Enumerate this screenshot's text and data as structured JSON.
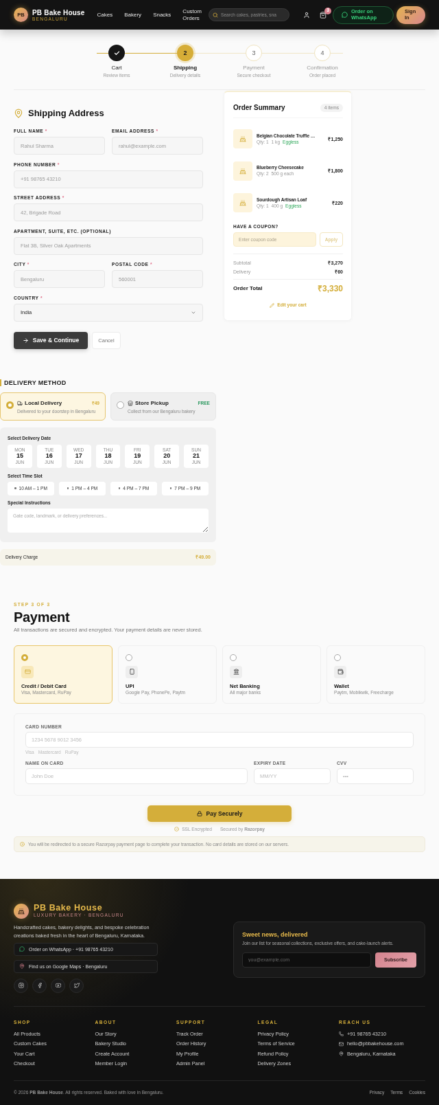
{
  "header": {
    "logo": "PB",
    "brand": "PB Bake House",
    "tagline": "BENGALURU",
    "nav": [
      "Cakes",
      "Bakery",
      "Snacks",
      "Custom Orders"
    ],
    "search": {
      "placeholder": "Search cakes, pastries, sna"
    },
    "cart_count": "3",
    "whatsapp": "Order on WhatsApp",
    "sign_in": "Sign In"
  },
  "stepper": {
    "steps": [
      {
        "label": "Cart",
        "note": "Review items",
        "completed": true,
        "selected": false
      },
      {
        "number": "2",
        "label": "Shipping",
        "note": "Delivery details",
        "completed": false,
        "selected": true
      },
      {
        "number": "3",
        "label": "Payment",
        "note": "Secure checkout",
        "completed": false,
        "selected": false
      },
      {
        "number": "4",
        "label": "Confirmation",
        "note": "Order placed",
        "completed": false,
        "selected": false
      }
    ]
  },
  "shipping": {
    "title": "Shipping Address",
    "rows": [
      [
        {
          "kind": "text",
          "label": "FULL NAME",
          "mark": "*",
          "placeholder": "Rahul Sharma"
        },
        {
          "kind": "text",
          "label": "EMAIL ADDRESS",
          "mark": "*",
          "placeholder": "rahul@example.com"
        }
      ],
      [
        {
          "kind": "text",
          "label": "PHONE NUMBER",
          "mark": "*",
          "placeholder": "+91 98765 43210"
        }
      ],
      [
        {
          "kind": "text",
          "label": "STREET ADDRESS",
          "mark": "*",
          "placeholder": "42, Brigade Road"
        }
      ],
      [
        {
          "kind": "text",
          "label": "APARTMENT, SUITE, ETC. (OPTIONAL)",
          "placeholder": "Flat 3B, Silver Oak Apartments"
        }
      ],
      [
        {
          "kind": "text",
          "label": "CITY",
          "mark": "*",
          "placeholder": "Bengaluru"
        },
        {
          "kind": "text",
          "label": "POSTAL CODE",
          "mark": "*",
          "placeholder": "560001"
        }
      ],
      [
        {
          "kind": "select",
          "label": "COUNTRY",
          "mark": "*",
          "value": "India"
        }
      ]
    ],
    "save": "Save & Continue",
    "cancel": "Cancel"
  },
  "order_summary": {
    "title": "Order Summary",
    "count": "4 items",
    "items": [
      {
        "name": "Belgian Chocolate Truffle …",
        "qty": "Qty: 1",
        "size": "1 kg",
        "tag": "Eggless",
        "price": "₹1,250"
      },
      {
        "name": "Blueberry Cheesecake",
        "qty": "Qty: 2",
        "size": "500 g each",
        "price": "₹1,800"
      },
      {
        "name": "Sourdough Artisan Loaf",
        "qty": "Qty: 1",
        "size": "400 g",
        "tag": "Eggless",
        "price": "₹220"
      }
    ],
    "coupon": {
      "label": "HAVE A COUPON?",
      "placeholder": "Enter coupon code",
      "button": "Apply",
      "disabled": true
    },
    "totals": [
      {
        "label": "Subtotal",
        "value": "₹3,270"
      },
      {
        "label": "Delivery",
        "value": "₹60"
      }
    ],
    "total": {
      "label": "Order Total",
      "value": "₹3,330"
    },
    "edit": "Edit your cart"
  },
  "delivery": {
    "title": "DELIVERY METHOD",
    "options": [
      {
        "kind": "delivery",
        "name": "Local Delivery",
        "price": "₹49",
        "description": "Delivered to your doorstep in Bengaluru",
        "selected": true
      },
      {
        "kind": "pickup",
        "name": "Store Pickup",
        "price": "FREE",
        "description": "Collect from our Bengaluru bakery",
        "selected": false
      }
    ],
    "date_label": "Select Delivery Date",
    "dates": [
      {
        "weekday": "MON",
        "day": "15",
        "month": "JUN",
        "selected": false
      },
      {
        "weekday": "TUE",
        "day": "16",
        "month": "JUN",
        "selected": false
      },
      {
        "weekday": "WED",
        "day": "17",
        "month": "JUN",
        "selected": false
      },
      {
        "weekday": "THU",
        "day": "18",
        "month": "JUN",
        "selected": false
      },
      {
        "weekday": "FRI",
        "day": "19",
        "month": "JUN",
        "selected": false
      },
      {
        "weekday": "SAT",
        "day": "20",
        "month": "JUN",
        "selected": false
      },
      {
        "weekday": "SUN",
        "day": "21",
        "month": "JUN",
        "selected": false
      }
    ],
    "slot_label": "Select Time Slot",
    "slots": [
      {
        "label": "10 AM – 1 PM",
        "selected": false
      },
      {
        "label": "1 PM – 4 PM",
        "selected": false
      },
      {
        "label": "4 PM – 7 PM",
        "selected": false
      },
      {
        "label": "7 PM – 9 PM",
        "selected": false
      }
    ],
    "instructions": {
      "label": "Special Instructions",
      "placeholder": "Gate code, landmark, or delivery preferences..."
    },
    "charge": {
      "label": "Delivery Charge",
      "value": "₹49.00"
    }
  },
  "payment": {
    "step": "STEP 3 OF 3",
    "title": "Payment",
    "subtitle": "All transactions are secured and encrypted. Your payment details are never stored.",
    "methods": [
      {
        "kind": "card",
        "name": "Credit / Debit Card",
        "description": "Visa, Mastercard, RuPay",
        "selected": true
      },
      {
        "kind": "upi",
        "name": "UPI",
        "description": "Google Pay, PhonePe, Paytm",
        "selected": false
      },
      {
        "kind": "netbanking",
        "name": "Net Banking",
        "description": "All major banks",
        "selected": false
      },
      {
        "kind": "wallet",
        "name": "Wallet",
        "description": "Paytm, Mobikwik, Freecharge",
        "selected": false
      }
    ],
    "card_form": {
      "number": {
        "label": "CARD NUMBER",
        "placeholder": "1234 5678 9012 3456"
      },
      "networks": [
        "Visa",
        "Mastercard",
        "RuPay"
      ],
      "name": {
        "label": "NAME ON CARD",
        "placeholder": "John Doe"
      },
      "expiry": {
        "label": "EXPIRY DATE",
        "placeholder": "MM/YY"
      },
      "cvv": {
        "label": "CVV",
        "placeholder": "•••"
      }
    },
    "pay_button": "Pay Securely",
    "ssl": "SSL Encrypted",
    "secured_by": "Secured by **Razorpay**",
    "notice": "You will be redirected to a secure Razorpay payment page to complete your transaction. No card details are stored on our servers."
  },
  "footer": {
    "brand": "PB Bake House",
    "tagline": "LUXURY BAKERY · BENGALURU",
    "description": "Handcrafted cakes, bakery delights, and bespoke celebration creations baked fresh in the heart of Bengaluru, Karnataka.",
    "contacts": [
      {
        "kind": "whatsapp",
        "text": "Order on WhatsApp · +91 98765 43210"
      },
      {
        "kind": "maps",
        "text": "Find us on Google Maps · Bengaluru"
      }
    ],
    "newsletter": {
      "title": "Sweet news, delivered",
      "text": "Join our list for seasonal collections, exclusive offers, and cake-launch alerts.",
      "placeholder": "you@example.com",
      "button": "Subscribe"
    },
    "columns": [
      {
        "title": "SHOP",
        "links": [
          "All Products",
          "Custom Cakes",
          "Your Cart",
          "Checkout"
        ]
      },
      {
        "title": "ABOUT",
        "links": [
          "Our Story",
          "Bakery Studio",
          "Create Account",
          "Member Login"
        ]
      },
      {
        "title": "SUPPORT",
        "links": [
          "Track Order",
          "Order History",
          "My Profile",
          "Admin Panel"
        ]
      },
      {
        "title": "LEGAL",
        "links": [
          "Privacy Policy",
          "Terms of Service",
          "Refund Policy",
          "Delivery Zones"
        ]
      }
    ],
    "reach": {
      "title": "REACH US",
      "items": [
        {
          "kind": "phone",
          "text": "+91 98765 43210"
        },
        {
          "kind": "email",
          "text": "hello@pbbakehouse.com"
        },
        {
          "kind": "location",
          "text": "Bengaluru, Karnataka"
        }
      ]
    },
    "copyright": "© 2026 **PB Bake House**. All rights reserved. Baked with love in Bengaluru.",
    "legal_links": [
      "Privacy",
      "Terms",
      "Cookies"
    ]
  }
}
